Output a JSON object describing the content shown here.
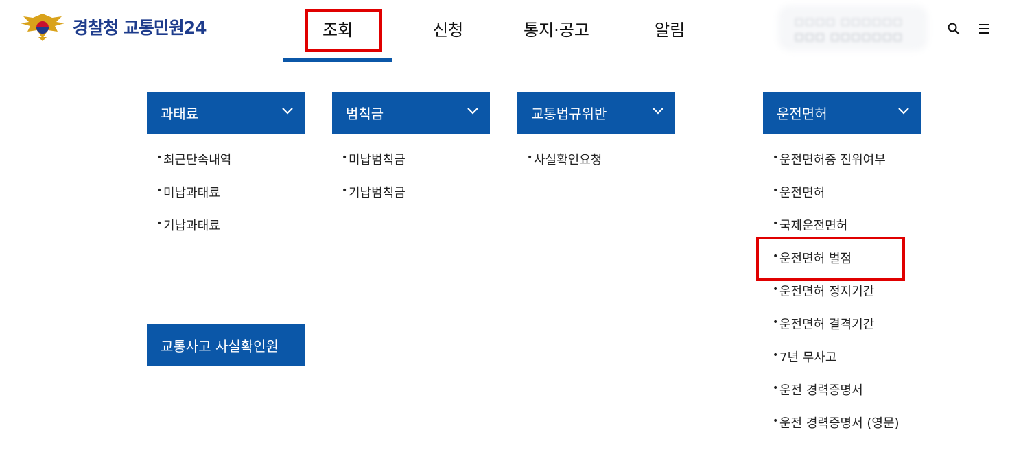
{
  "header": {
    "logo_text": "경찰청 교통민원24",
    "nav": [
      {
        "label": "조회"
      },
      {
        "label": "신청"
      },
      {
        "label": "통지·공고"
      },
      {
        "label": "알림"
      }
    ],
    "user_line1": "□□□□ □□□□□□",
    "user_line2": "□□□ □□□□□□□",
    "search_icon": "search-icon",
    "menu_icon": "hamburger-menu-icon"
  },
  "menu": {
    "fine": {
      "title": "과태료",
      "items": [
        "최근단속내역",
        "미납과태료",
        "기납과태료"
      ]
    },
    "penalty": {
      "title": "범칙금",
      "items": [
        "미납범칙금",
        "기납범칙금"
      ]
    },
    "violation": {
      "title": "교통법규위반",
      "items": [
        "사실확인요청"
      ]
    },
    "accident": {
      "title": "교통사고 사실확인원"
    },
    "license": {
      "title": "운전면허",
      "items": [
        "운전면허증 진위여부",
        "운전면허",
        "국제운전면허",
        "운전면허 벌점",
        "운전면허 정지기간",
        "운전면허 결격기간",
        "7년 무사고",
        "운전 경력증명서",
        "운전 경력증명서 (영문)"
      ]
    }
  },
  "colors": {
    "accent": "#0b57a8",
    "highlight": "#e00000",
    "logo_text": "#1e3c8c"
  }
}
